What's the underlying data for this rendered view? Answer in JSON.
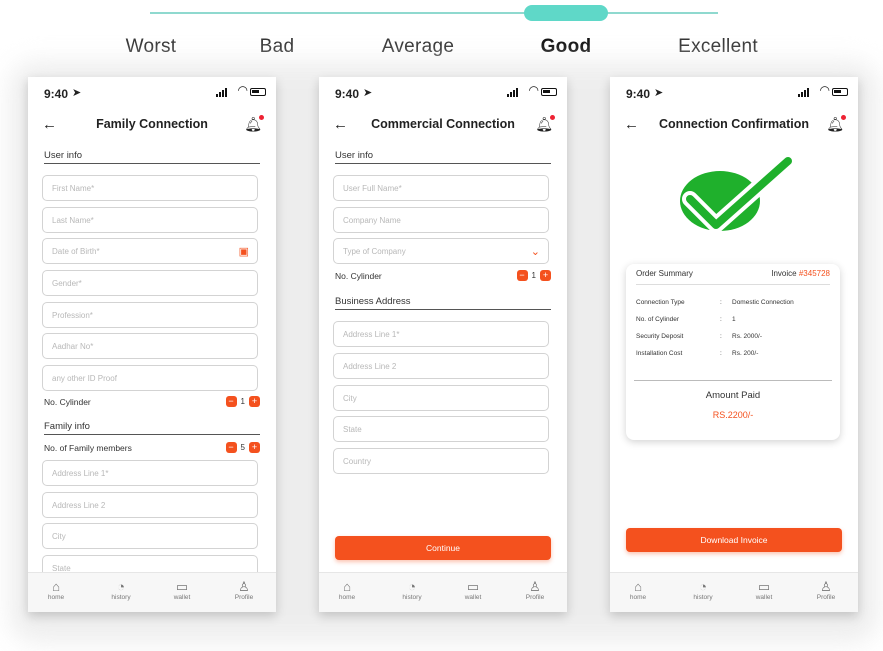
{
  "rating": {
    "labels": [
      "Worst",
      "Bad",
      "Average",
      "Good",
      "Excellent"
    ],
    "selected": "Good"
  },
  "status": {
    "time": "9:40"
  },
  "nav": [
    {
      "label": "home",
      "icon": "home-icon"
    },
    {
      "label": "history",
      "icon": "history-icon"
    },
    {
      "label": "wallet",
      "icon": "wallet-icon"
    },
    {
      "label": "Profile",
      "icon": "profile-icon"
    }
  ],
  "screen1": {
    "title": "Family Connection",
    "user_info": "User info",
    "fields": {
      "first_name": "First Name*",
      "last_name": "Last Name*",
      "dob": "Date of Birth*",
      "gender": "Gender*",
      "profession": "Profession*",
      "aadhar": "Aadhar No*",
      "other_id": "any other ID Proof"
    },
    "cylinder_label": "No. Cylinder",
    "cylinder_count": "1",
    "family_info": "Family info",
    "members_label": "No. of Family members",
    "members_count": "5",
    "address": {
      "line1": "Address Line 1*",
      "line2": "Address Line 2",
      "city": "City",
      "state": "State"
    }
  },
  "screen2": {
    "title": "Commercial Connection",
    "user_info": "User info",
    "fields": {
      "full_name": "User Full Name*",
      "company": "Company Name",
      "type": "Type of Company"
    },
    "cylinder_label": "No. Cylinder",
    "cylinder_count": "1",
    "business_address": "Business Address",
    "address": {
      "line1": "Address Line 1*",
      "line2": "Address Line 2",
      "city": "City",
      "state": "State",
      "country": "Country"
    },
    "continue": "Continue"
  },
  "screen3": {
    "title": "Connection Confirmation",
    "summary_title": "Order Summary",
    "invoice_prefix": "Invoice",
    "invoice_no": "#345728",
    "rows": [
      {
        "k": "Connection Type",
        "c": ":",
        "v": "Domestic Connection"
      },
      {
        "k": "No. of Cylinder",
        "c": ":",
        "v": "1"
      },
      {
        "k": "Security Deposit",
        "c": ":",
        "v": "Rs. 2000/-"
      },
      {
        "k": "Installation Cost",
        "c": ":",
        "v": "Rs. 200/-"
      }
    ],
    "amount_label": "Amount Paid",
    "amount_value": "RS.2200/-",
    "download": "Download Invoice"
  },
  "colors": {
    "accent": "#f4511e",
    "slider": "#5fd8c8",
    "check": "#1fb02c"
  }
}
